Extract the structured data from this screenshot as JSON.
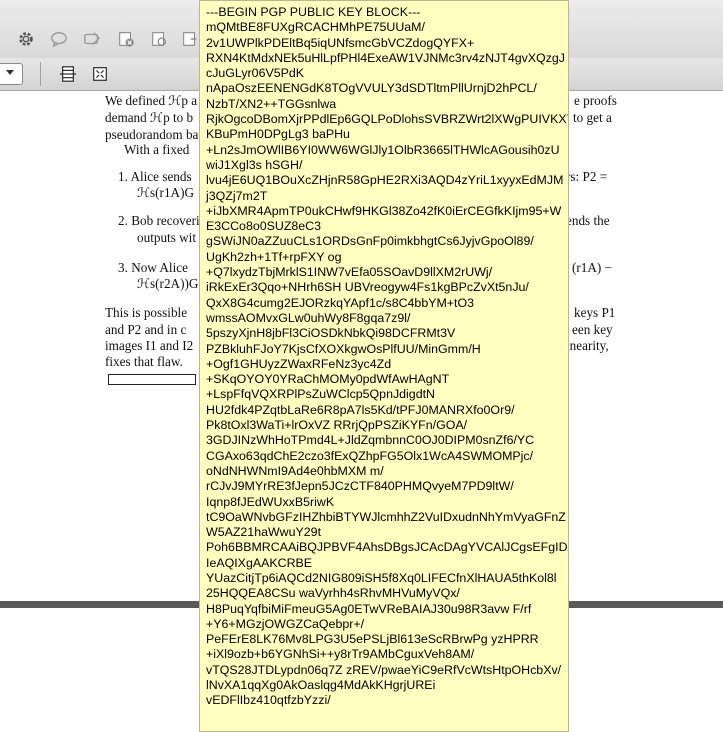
{
  "toolbar": {
    "icons": [
      "gear-icon",
      "comment-icon",
      "highlight-icon",
      "delete-icon",
      "copy-icon",
      "replace-icon"
    ],
    "row2_icons": [
      "dropdown-icon",
      "page-layout-icon",
      "fit-page-icon"
    ]
  },
  "document": {
    "lines": [
      "We defined ℋp a",
      "demand ℋp to b",
      "pseudorandom ba",
      "With a fixed",
      "1.  Alice sends",
      "ℋs(r1A)G",
      "2.  Bob recoveri",
      "outputs wit",
      "3.  Now Alice",
      "ℋs(r2A))G",
      "This is possible",
      "and P2 and in c",
      "images I1 and I2",
      "fixes that flaw."
    ],
    "right_fragments": [
      "e proofs",
      "to get a",
      "rs: P2 =",
      "ends the",
      "(r1A) −",
      "keys P1",
      "een key",
      "inearity,"
    ]
  },
  "tooltip": {
    "lines": [
      "---BEGIN PGP PUBLIC KEY BLOCK---",
      "mQMtBE8FUXgRCACHMhPE75UUaM/",
      "2v1UWPlkPDEltBq5iqUNfsmcGbVCZdogQYFX+",
      "RXN4KtMdxNEk5uHlLpfPHl4ExeAW1VJNMc3rv4zNJT4gvXQzgJ",
      "cJuGLyr06V5PdK",
      "nApaOszEENENGdK8TOgVVULY3dSDTltmPllUrnjD2hPCL/",
      "NzbT/XN2++TGGsnlwa",
      "RjkOgcoDBomXjrPPdlEp6GQLPoDlohsSVBRZWrt2lXWgPUIVKX7",
      "KBuPmH0DPgLg3 baPHu",
      "+Ln2sJmOWlIB6YI0WW6WGlJly1OlbR3665lTHWlcAGousih0zU",
      "wiJ1Xgl3s hSGH/",
      "lvu4jE6UQ1BOuXcZHjnR58GpHE2RXi3AQD4zYriL1xyyxEdMJM",
      "j3QZj7m2T",
      "+iJbXMR4ApmTP0ukCHwf9HKGl38Zo42fK0iErCEGfkKIjm95+W",
      "E3CCo8o0SUZ8eC3",
      "gSWiJN0aZZuuCLs1ORDsGnFp0imkbhgtCs6JyjvGpoOl89/",
      "UgKh2zh+1Tf+rpFXY og",
      "+Q7lxydzTbjMrklS1INW7vEfa05SOavD9llXM2rUWj/",
      "iRkExEr3Qqo+NHrh6SH UBVreogyw4Fs1kgBPcZvXt5nJu/",
      "QxX8G4cumg2EJORzkqYApf1c/s8C4bbYM+tO3",
      "wmssAOMvxGLw0uhWy8F8gqa7z9l/",
      "5pszyXjnH8jbFl3CiOSDkNbkQi98DCFRMt3V",
      "PZBkluhFJoY7KjsCfXOXkgwOsPlfUU/MinGmm/H",
      "+Ogf1GHUyzZWaxRFeNz3yc4Zd",
      "+SKqOYOY0YRaChMOMy0pdWfAwHAgNT",
      "+LspFfqVQXRPlPsZuWClcp5QpnJdigdtN",
      "HU2fdk4PZqtbLaRe6R8pA7ls5Kd/tPFJ0MANRXfo0Or9/",
      "Pk8tOxl3WaTi+lrOxVZ RRrjQpPSZiKYFn/GOA/",
      "3GDJINzWhHoTPmd4L+JldZqmbnnC0OJ0DIPM0snZf6/YC",
      "CGAxo63qdChE2czo3fExQZhpFG5Olx1WcA4SWMOMPjc/",
      "oNdNHWNmI9Ad4e0hbMXM m/",
      "rCJvJ9MYrRE3fJepn5JCzCTF840PHMQvyeM7PD9ltW/",
      "Iqnp8fJEdWUxxB5riwK",
      "tC9OaWNvbGFzIHZhbiBTYWJlcmhhZ2VuIDxudnNhYmVyaGFnZ",
      "W5AZ21haWwuY29t",
      "Poh6BBMRCAAiBQJPBVF4AhsDBgsJCAcDAgYVCAlJCgsEFgIDAQ",
      "IeAQIXgAAKCRBE",
      "YUazCitjTp6iAQCd2NIG809iSH5f8Xq0LIFECfnXlHAUA5thKol8l",
      "25HQQEA8CSu waVyrhh4sRhvMHVuMyVQx/",
      "H8PuqYqfbiMiFmeuG5Ag0ETwVReBAIAJ30u98R3avw F/rf",
      "+Y6+MGzjOWGZCaQebpr+/",
      "PeFErE8LK76Mv8LPG3U5ePSLjBl613eScRBrwPg yzHPRR",
      "+iXl9ozb+b6YGNhSi++y8rTr9AMbCguxVeh8AM/",
      "vTQS28JTDLypdn06q7Z zREV/pwaeYiC9eRfVcWtsHtpOHcbXv/",
      "lNvXA1qqXg0AkOaslqg4MdAkKHgrjUREi",
      "vEDFlIbz410qtfzbYzzi/"
    ]
  }
}
